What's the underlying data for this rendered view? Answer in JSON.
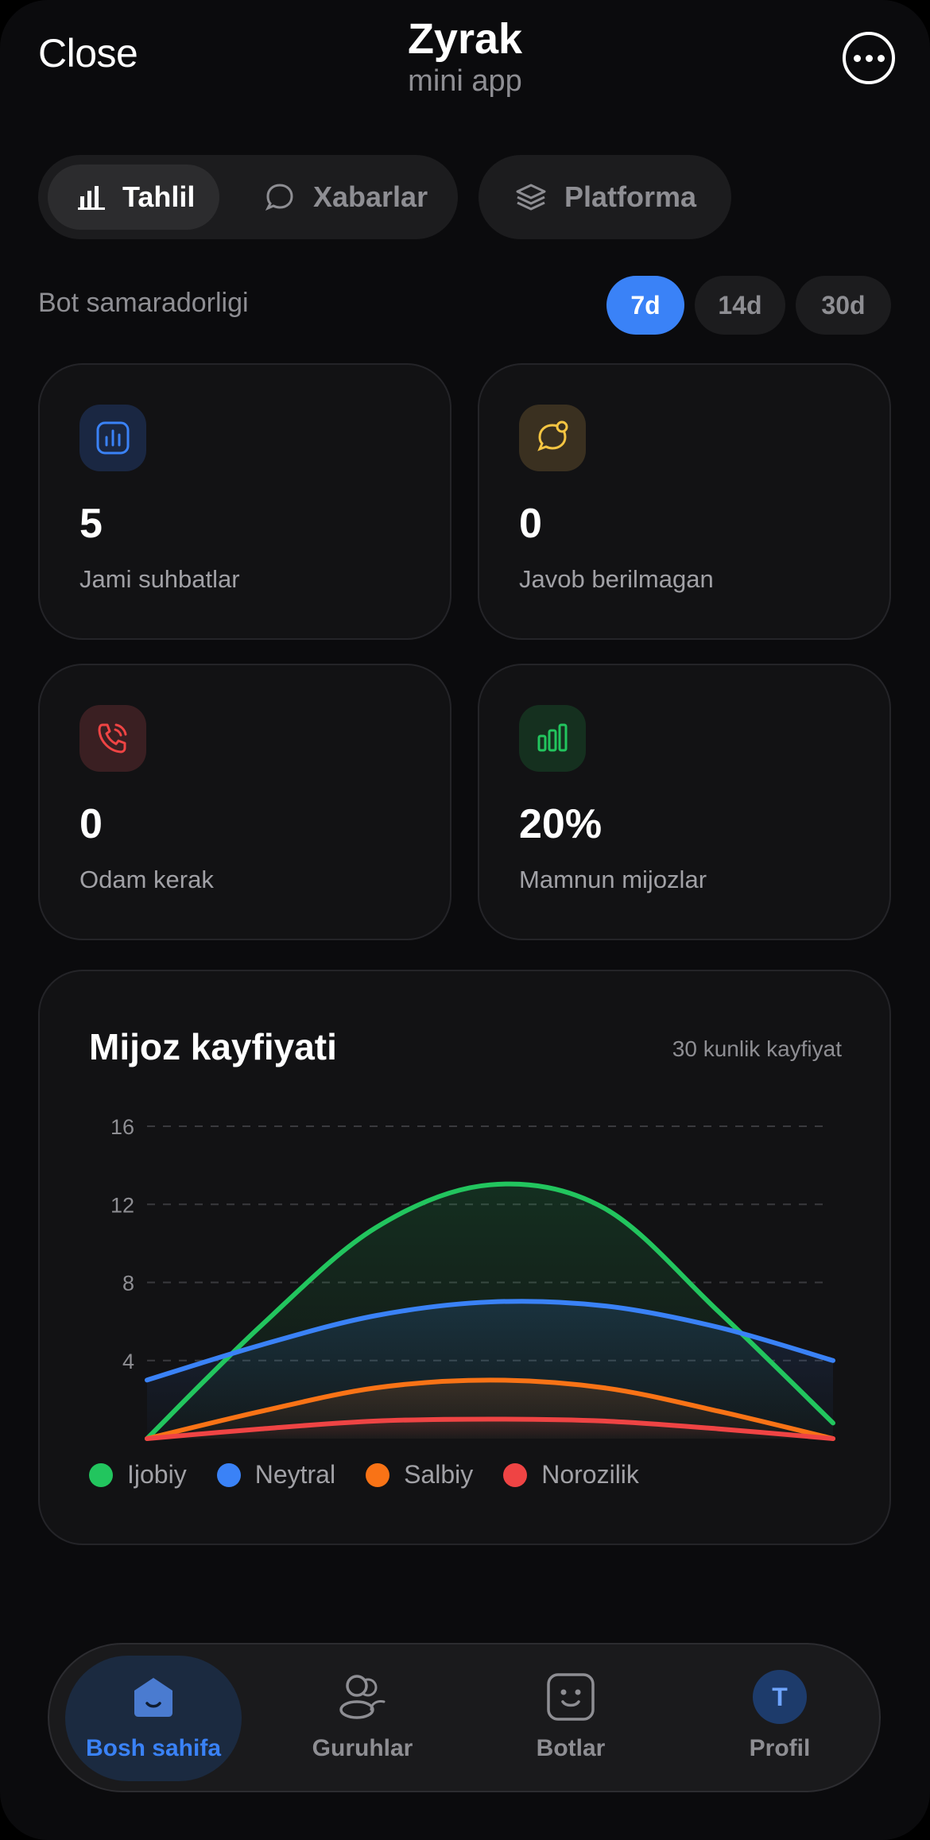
{
  "header": {
    "close_label": "Close",
    "title": "Zyrak",
    "subtitle": "mini app",
    "more_icon": "more-horizontal-icon"
  },
  "tabs": [
    {
      "label": "Tahlil",
      "icon": "bar-chart-icon",
      "active": true
    },
    {
      "label": "Xabarlar",
      "icon": "chat-bubble-icon",
      "active": false
    },
    {
      "label": "Platforma",
      "icon": "layers-icon",
      "active": false
    }
  ],
  "section": {
    "label": "Bot samaradorligi",
    "periods": [
      {
        "label": "7d",
        "active": true
      },
      {
        "label": "14d",
        "active": false
      },
      {
        "label": "30d",
        "active": false
      }
    ]
  },
  "stats": [
    {
      "value": "5",
      "label": "Jami suhbatlar",
      "icon": "bar-chart-square-icon",
      "color": "#3a82f7"
    },
    {
      "value": "0",
      "label": "Javob berilmagan",
      "icon": "chat-notification-icon",
      "color": "#f5c542"
    },
    {
      "value": "0",
      "label": "Odam kerak",
      "icon": "phone-call-icon",
      "color": "#ef4444"
    },
    {
      "value": "20%",
      "label": "Mamnun mijozlar",
      "icon": "bar-chart-green-icon",
      "color": "#22c55e"
    }
  ],
  "chart": {
    "title": "Mijoz kayfiyati",
    "subtitle": "30 kunlik kayfiyat"
  },
  "chart_data": {
    "type": "area",
    "x": [
      0,
      1,
      2,
      3,
      4,
      5,
      6
    ],
    "ylim": [
      0,
      16
    ],
    "yticks": [
      "16",
      "12",
      "8",
      "4"
    ],
    "grid": true,
    "legend_position": "bottom-left",
    "series": [
      {
        "name": "Ijobiy",
        "color": "#22c55e",
        "values": [
          0,
          5.8,
          10.8,
          13,
          11.8,
          6.5,
          0.8
        ]
      },
      {
        "name": "Neytral",
        "color": "#3a82f7",
        "values": [
          3,
          4.8,
          6.3,
          7,
          6.8,
          5.7,
          4
        ]
      },
      {
        "name": "Salbiy",
        "color": "#f97316",
        "values": [
          0,
          1.4,
          2.6,
          3,
          2.6,
          1.4,
          0
        ]
      },
      {
        "name": "Norozilik",
        "color": "#ef4444",
        "values": [
          0,
          0.5,
          0.9,
          1,
          0.9,
          0.5,
          0
        ]
      }
    ]
  },
  "nav": [
    {
      "label": "Bosh sahifa",
      "icon": "home-icon",
      "active": true
    },
    {
      "label": "Guruhlar",
      "icon": "users-icon",
      "active": false
    },
    {
      "label": "Botlar",
      "icon": "bot-icon",
      "active": false
    },
    {
      "label": "Profil",
      "icon": "avatar-icon",
      "avatar_letter": "T",
      "active": false
    }
  ]
}
